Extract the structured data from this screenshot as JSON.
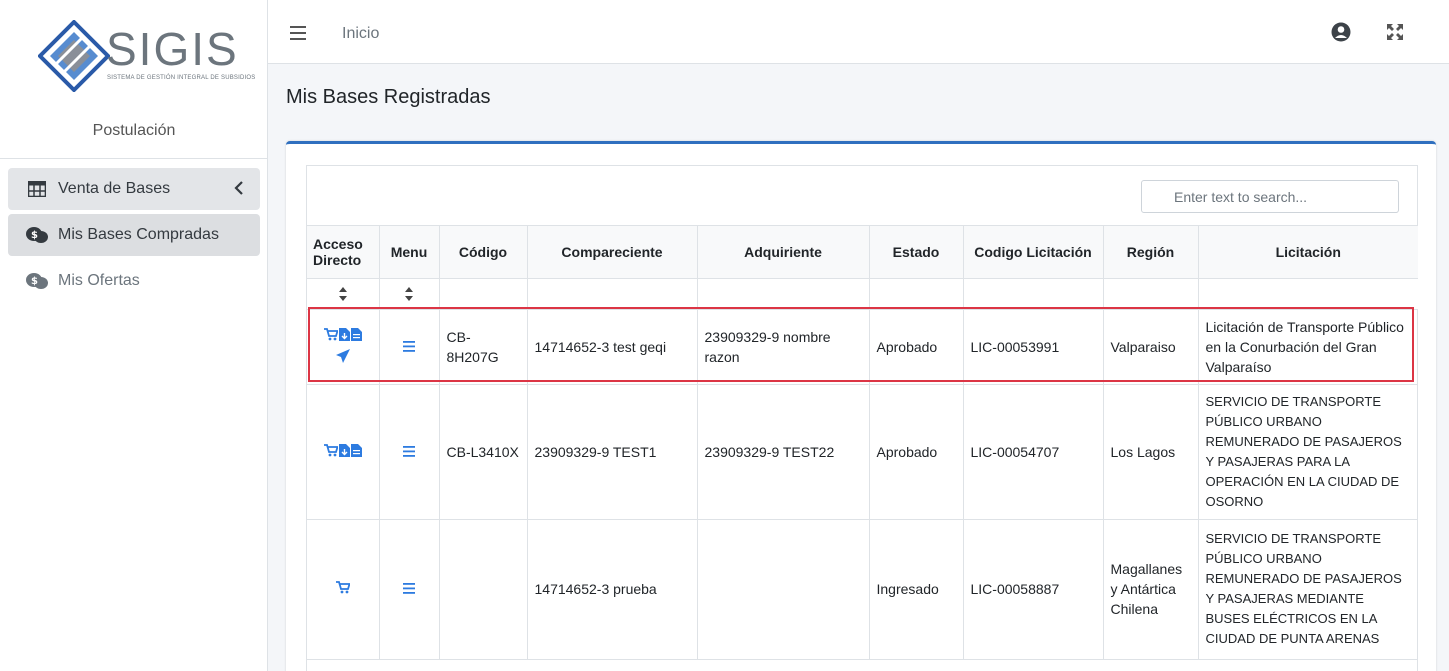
{
  "sidebar": {
    "logo_text": "SIGIS",
    "logo_subtitle": "SISTEMA DE GESTIÓN INTEGRAL DE SUBSIDIOS",
    "section_label": "Postulación",
    "items": [
      {
        "label": "Venta de Bases",
        "icon": "table-icon"
      },
      {
        "label": "Mis Bases Compradas",
        "icon": "money-chat-icon"
      },
      {
        "label": "Mis Ofertas",
        "icon": "money-chat-icon"
      }
    ]
  },
  "header": {
    "breadcrumb": "Inicio"
  },
  "page": {
    "title": "Mis Bases Registradas"
  },
  "search": {
    "placeholder": "Enter text to search..."
  },
  "table": {
    "columns": [
      "Acceso Directo",
      "Menu",
      "Código",
      "Compareciente",
      "Adquiriente",
      "Estado",
      "Codigo Licitación",
      "Región",
      "Licitación"
    ],
    "rows": [
      {
        "codigo": "CB-8H207G",
        "compareciente": "14714652-3 test geqi",
        "adquiriente": "23909329-9 nombre razon",
        "estado": "Aprobado",
        "codigo_licitacion": "LIC-00053991",
        "region": "Valparaiso",
        "licitacion": "Licitación de Transporte Público en la Conurbación del Gran Valparaíso"
      },
      {
        "codigo": "CB-L3410X",
        "compareciente": "23909329-9 TEST1",
        "adquiriente": "23909329-9 TEST22",
        "estado": "Aprobado",
        "codigo_licitacion": "LIC-00054707",
        "region": "Los Lagos",
        "licitacion": "SERVICIO DE TRANSPORTE PÚBLICO URBANO REMUNERADO DE PASAJEROS Y PASAJERAS PARA LA OPERACIÓN EN LA CIUDAD DE OSORNO"
      },
      {
        "codigo": "",
        "compareciente": "14714652-3 prueba",
        "adquiriente": "",
        "estado": "Ingresado",
        "codigo_licitacion": "LIC-00058887",
        "region": "Magallanes y Antártica Chilena",
        "licitacion": "SERVICIO DE TRANSPORTE PÚBLICO URBANO REMUNERADO DE PASAJEROS Y PASAJERAS MEDIANTE BUSES ELÉCTRICOS EN LA CIUDAD DE PUNTA ARENAS"
      }
    ]
  },
  "colors": {
    "accent": "#2f6fbf",
    "icon_blue": "#2d7be0",
    "highlight": "#dc3545"
  }
}
